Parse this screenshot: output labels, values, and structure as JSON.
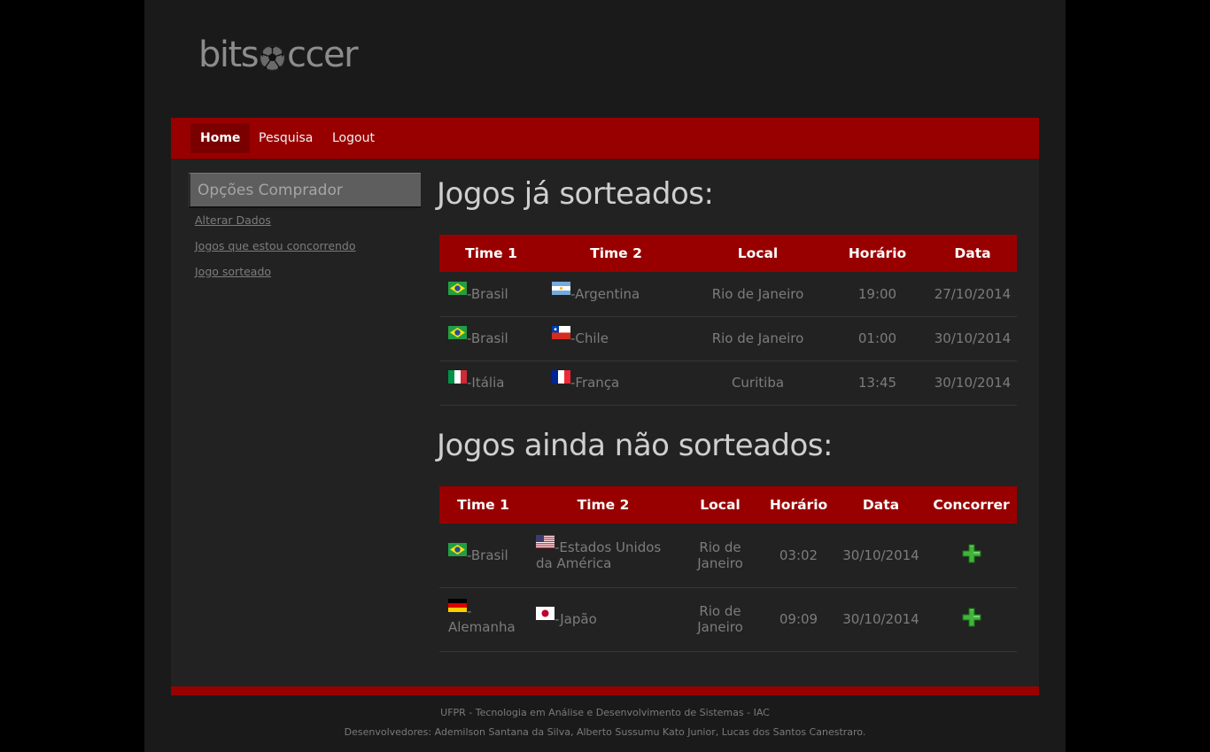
{
  "brand": {
    "prefix": "bits",
    "suffix": "ccer"
  },
  "nav": {
    "items": [
      "Home",
      "Pesquisa",
      "Logout"
    ]
  },
  "sidebar": {
    "title": "Opções Comprador",
    "links": [
      "Alterar Dados",
      "Jogos que estou concorrendo",
      "Jogo sorteado"
    ]
  },
  "drawn": {
    "title": "Jogos já sorteados:",
    "headers": [
      "Time 1",
      "Time 2",
      "Local",
      "Horário",
      "Data"
    ],
    "rows": [
      {
        "team1": "-Brasil",
        "flag1": "brazil-flag-icon",
        "team2": "-Argentina",
        "flag2": "argentina-flag-icon",
        "local": "Rio de Janeiro",
        "time": "19:00",
        "date": "27/10/2014"
      },
      {
        "team1": "-Brasil",
        "flag1": "brazil-flag-icon",
        "team2": "-Chile",
        "flag2": "chile-flag-icon",
        "local": "Rio de Janeiro",
        "time": "01:00",
        "date": "30/10/2014"
      },
      {
        "team1": "-Itália",
        "flag1": "italy-flag-icon",
        "team2": "-França",
        "flag2": "france-flag-icon",
        "local": "Curitiba",
        "time": "13:45",
        "date": "30/10/2014"
      }
    ]
  },
  "pending": {
    "title": "Jogos ainda não sorteados:",
    "headers": [
      "Time 1",
      "Time 2",
      "Local",
      "Horário",
      "Data",
      "Concorrer"
    ],
    "rows": [
      {
        "team1": "-Brasil",
        "flag1": "brazil-flag-icon",
        "team2": "-Estados Unidos da América",
        "flag2": "usa-flag-icon",
        "local": "Rio de Janeiro",
        "time": "03:02",
        "date": "30/10/2014",
        "action": "plus-icon"
      },
      {
        "team1": "-Alemanha",
        "flag1": "germany-flag-icon",
        "team2": "-Japão",
        "flag2": "japan-flag-icon",
        "local": "Rio de Janeiro",
        "time": "09:09",
        "date": "30/10/2014",
        "action": "plus-icon"
      }
    ]
  },
  "footer": {
    "line1": "UFPR - Tecnologia em Análise e Desenvolvimento de Sistemas - IAC",
    "line2": "Desenvolvedores: Ademilson Santana da Silva, Alberto Sussumu Kato Junior, Lucas dos Santos Canestraro."
  },
  "colors": {
    "accent": "#980000",
    "background": "#000000",
    "panel": "#222222"
  }
}
